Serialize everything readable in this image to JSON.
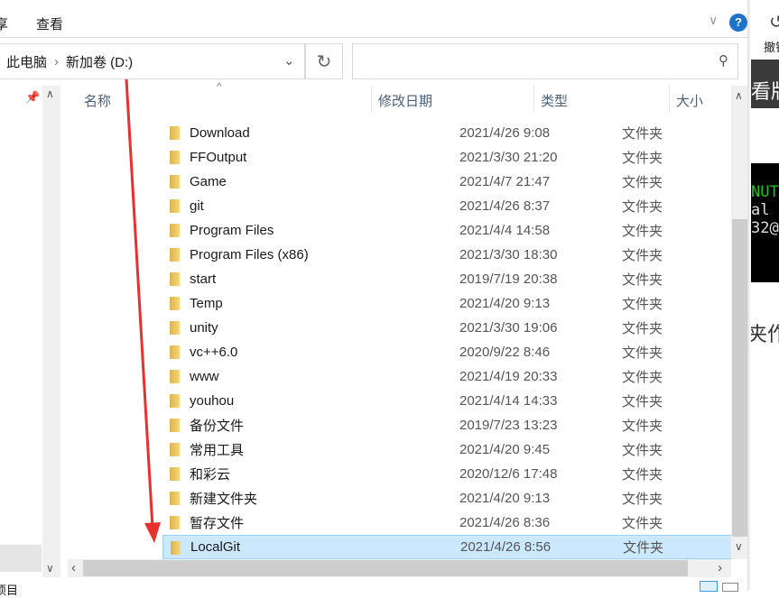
{
  "ribbon": {
    "tab_partial": "享",
    "tab_view": "查看"
  },
  "address": {
    "crumbs": [
      "此电脑",
      "新加卷 (D:)"
    ]
  },
  "search": {
    "placeholder": ""
  },
  "columns": {
    "name": "名称",
    "date": "修改日期",
    "type": "类型",
    "size": "大小"
  },
  "rows": [
    {
      "name": "Download",
      "date": "2021/4/26 9:08",
      "type": "文件夹"
    },
    {
      "name": "FFOutput",
      "date": "2021/3/30 21:20",
      "type": "文件夹"
    },
    {
      "name": "Game",
      "date": "2021/4/7 21:47",
      "type": "文件夹"
    },
    {
      "name": "git",
      "date": "2021/4/26 8:37",
      "type": "文件夹"
    },
    {
      "name": "Program Files",
      "date": "2021/4/4 14:58",
      "type": "文件夹"
    },
    {
      "name": "Program Files (x86)",
      "date": "2021/3/30 18:30",
      "type": "文件夹"
    },
    {
      "name": "start",
      "date": "2019/7/19 20:38",
      "type": "文件夹"
    },
    {
      "name": "Temp",
      "date": "2021/4/20 9:13",
      "type": "文件夹"
    },
    {
      "name": "unity",
      "date": "2021/3/30 19:06",
      "type": "文件夹"
    },
    {
      "name": "vc++6.0",
      "date": "2020/9/22 8:46",
      "type": "文件夹"
    },
    {
      "name": "www",
      "date": "2021/4/19 20:33",
      "type": "文件夹"
    },
    {
      "name": "youhou",
      "date": "2021/4/14 14:33",
      "type": "文件夹"
    },
    {
      "name": "备份文件",
      "date": "2019/7/23 13:23",
      "type": "文件夹"
    },
    {
      "name": "常用工具",
      "date": "2021/4/20 9:45",
      "type": "文件夹"
    },
    {
      "name": "和彩云",
      "date": "2020/12/6 17:48",
      "type": "文件夹"
    },
    {
      "name": "新建文件夹",
      "date": "2021/4/20 9:13",
      "type": "文件夹"
    },
    {
      "name": "暂存文件",
      "date": "2021/4/26 8:36",
      "type": "文件夹"
    },
    {
      "name": "LocalGit",
      "date": "2021/4/26 8:56",
      "type": "文件夹",
      "selected": true
    }
  ],
  "status": {
    "partial": "项目"
  },
  "background": {
    "undo": "撤销",
    "text1": "看版",
    "term": [
      "NUT",
      "al",
      "32@"
    ],
    "text2": "夹作"
  },
  "colors": {
    "selection": "#cce8ff",
    "arrow": "#e8312f",
    "help": "#1e73c8"
  }
}
